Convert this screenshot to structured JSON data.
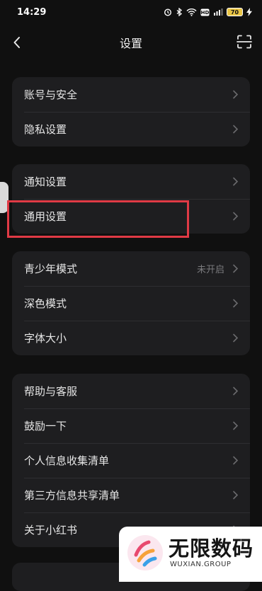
{
  "status_bar": {
    "time": "14:29",
    "battery": "70"
  },
  "header": {
    "title": "设置"
  },
  "groups": [
    {
      "items": [
        {
          "label": "账号与安全"
        },
        {
          "label": "隐私设置"
        }
      ]
    },
    {
      "items": [
        {
          "label": "通知设置"
        },
        {
          "label": "通用设置"
        }
      ]
    },
    {
      "items": [
        {
          "label": "青少年模式",
          "value": "未开启"
        },
        {
          "label": "深色模式"
        },
        {
          "label": "字体大小"
        }
      ]
    },
    {
      "items": [
        {
          "label": "帮助与客服"
        },
        {
          "label": "鼓励一下"
        },
        {
          "label": "个人信息收集清单"
        },
        {
          "label": "第三方信息共享清单"
        },
        {
          "label": "关于小红书"
        }
      ]
    }
  ],
  "watermark": {
    "brand": "无限数码",
    "url": "WUXIAN.GROUP"
  },
  "colors": {
    "background": "#101010",
    "card": "#1e1e20",
    "highlight": "#e03a45"
  }
}
